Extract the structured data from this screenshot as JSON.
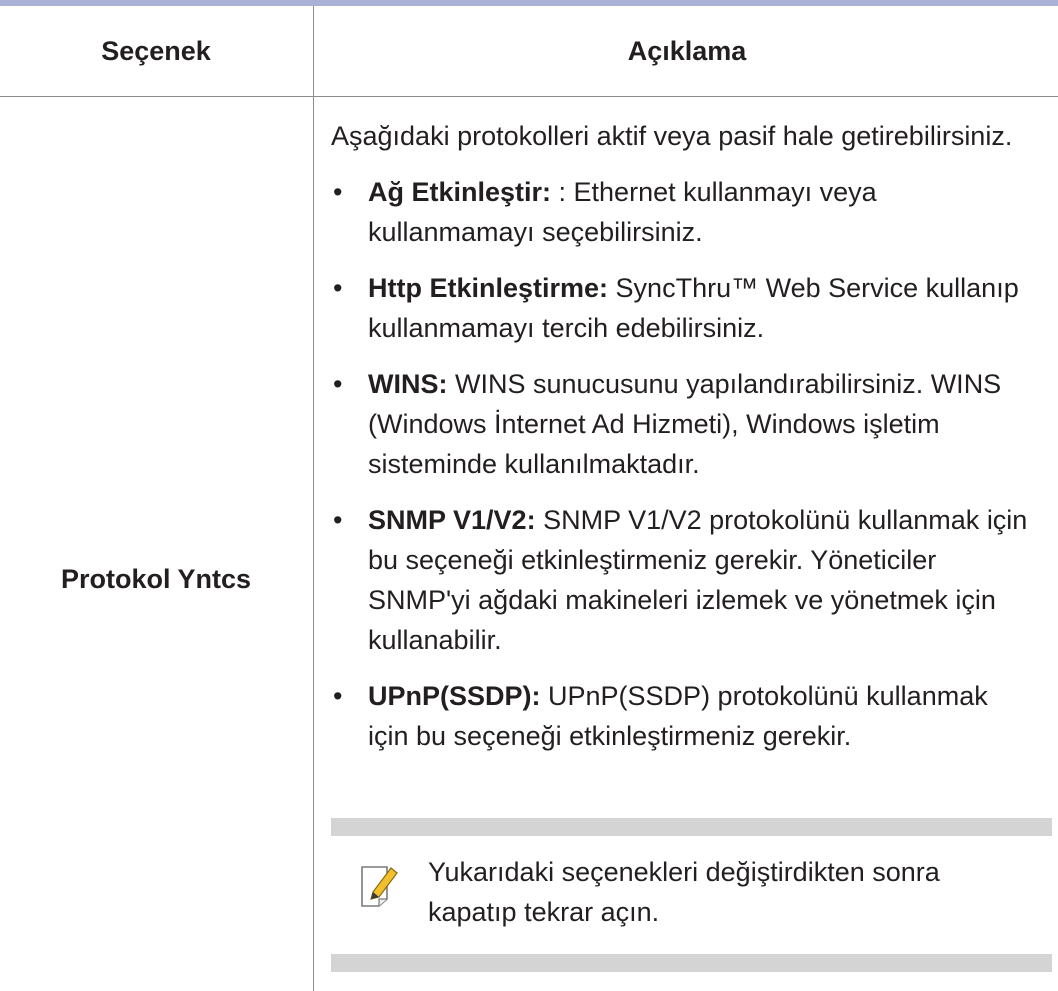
{
  "table": {
    "header": {
      "option": "Seçenek",
      "description": "Açıklama"
    },
    "row": {
      "option": "Protokol Yntcs",
      "intro": "Aşağıdaki protokolleri aktif veya pasif hale getirebilirsiniz.",
      "bullet_char": "•",
      "items": [
        {
          "term": "Ağ Etkinleştir:",
          "text": " : Ethernet kullanmayı veya kullanmamayı seçebilirsiniz."
        },
        {
          "term": "Http Etkinleştirme:",
          "text": " SyncThru™ Web Service kullanıp kullanmamayı tercih edebilirsiniz."
        },
        {
          "term": "WINS:",
          "text": " WINS sunucusunu yapılandırabilirsiniz. WINS (Windows İnternet Ad Hizmeti), Windows işletim sisteminde kullanılmaktadır."
        },
        {
          "term": "SNMP V1/V2:",
          "text": " SNMP V1/V2 protokolünü kullanmak için bu seçeneği etkinleştirmeniz gerekir. Yöneticiler SNMP'yi ağdaki makineleri izlemek ve yönetmek için kullanabilir."
        },
        {
          "term": "UPnP(SSDP):",
          "text": " UPnP(SSDP) protokolünü kullanmak için bu seçeneği etkinleştirmeniz gerekir."
        }
      ],
      "note": {
        "icon": "note-pencil-icon",
        "text": "Yukarıdaki seçenekleri değiştirdikten sonra kapatıp tekrar açın."
      }
    }
  },
  "colors": {
    "header_rule": "#aab0d6",
    "note_band": "#d4d4d4",
    "pencil": "#f2c02f"
  }
}
